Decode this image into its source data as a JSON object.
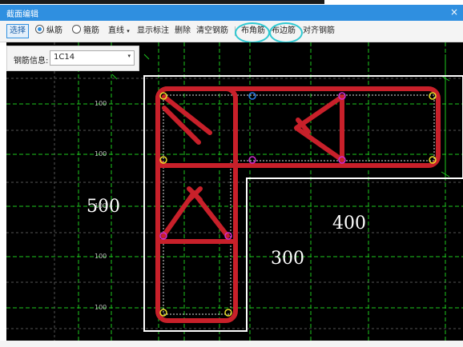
{
  "window": {
    "title": "截面编辑",
    "close": "×"
  },
  "toolbar": {
    "select": "选择",
    "longitudinal": "纵筋",
    "stirrup": "箍筋",
    "line": "直线",
    "line_arrow": "▾",
    "show_marks": "显示标注",
    "delete": "删除",
    "clear_rebar": "清空钢筋",
    "corner_rebar": "布角筋",
    "edge_rebar": "布边筋",
    "align_rebar": "对齐钢筋"
  },
  "rebar_info": {
    "label": "钢筋信息:",
    "value": "1C14",
    "arrow": "▾"
  },
  "drawing": {
    "dim_large": [
      "500",
      "400",
      "300"
    ],
    "dim_small": [
      "100",
      "100",
      "100",
      "100",
      "100"
    ]
  },
  "colors": {
    "title_bar": "#2f8fe0",
    "rebar": "#c8202a",
    "highlight": "#2fc9d2",
    "grid": "#1ec81e",
    "outline": "#ffffff"
  }
}
